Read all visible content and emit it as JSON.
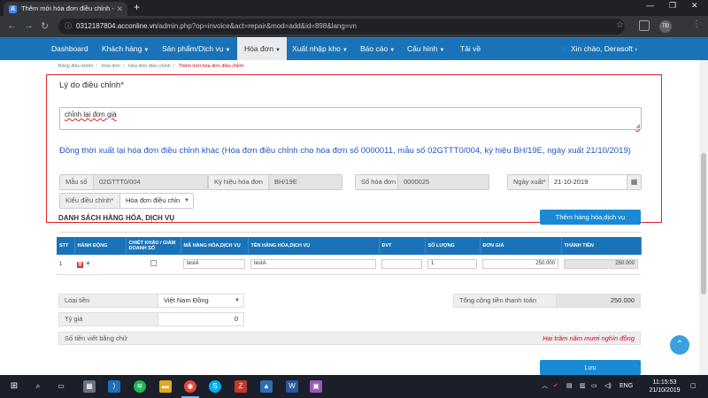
{
  "browser": {
    "tab_title": "Thêm mới hóa đơn điều chỉnh - ",
    "tab_favicon_letter": "A",
    "new_tab": "+",
    "url_host": "0312187804.acconline.vn",
    "url_path": "/admin.php?op=invoice&act=repair&mod=add&id=898&lang=vn",
    "profile_initials": "TĐ"
  },
  "nav": {
    "items": [
      {
        "label": "Dashboard",
        "caret": false
      },
      {
        "label": "Khách hàng",
        "caret": true
      },
      {
        "label": "Sản phẩm/Dịch vụ",
        "caret": true
      },
      {
        "label": "Hóa đơn",
        "caret": true,
        "active": true
      },
      {
        "label": "Xuất nhập kho",
        "caret": true
      },
      {
        "label": "Báo cáo",
        "caret": true
      },
      {
        "label": "Cấu hình",
        "caret": true
      },
      {
        "label": "Tải về",
        "caret": false
      }
    ],
    "user_greeting": "Xin chào, Derasoft"
  },
  "breadcrumb": [
    "Bảng điều khiển",
    "Hóa đơn",
    "Hóa đơn điều chỉnh",
    "Thêm mới hóa đơn điều chỉnh"
  ],
  "form": {
    "reason_label": "Lý do điều chỉnh*",
    "reason_value": "chỉnh lại đơn giá",
    "notice": "Đồng thời xuất lại hóa đơn điều chỉnh khác (Hóa đơn điều chỉnh cho hóa đơn số 0000011, mẫu số 02GTTT0/004, ký hiệu BH/19E, ngày xuất 21/10/2019)",
    "mau_so_label": "Mẫu số",
    "mau_so_value": "02GTTT0/004",
    "ky_hieu_label": "Ký hiệu hóa đơn",
    "ky_hieu_value": "BH/19E",
    "so_hd_label": "Số hóa đơn",
    "so_hd_value": "0000025",
    "ngay_xuat_label": "Ngày xuất*",
    "ngay_xuat_value": "21-10-2019",
    "kieu_label": "Kiểu điều chỉnh*",
    "kieu_value": "Hóa đơn điều chỉn"
  },
  "items_section": {
    "title": "DANH SÁCH HÀNG HÓA, DỊCH VỤ",
    "add_button": "Thêm hàng hóa,dịch vụ",
    "columns": [
      "STT",
      "HÀNH ĐỘNG",
      "CHIẾT KHẤU / GIẢM DOANH SỐ",
      "MÃ HÀNG HÓA,DỊCH VỤ",
      "TÊN HÀNG HÓA,DỊCH VỤ",
      "ĐVT",
      "SỐ LƯỢNG",
      "ĐƠN GIÁ",
      "THÀNH TIỀN"
    ],
    "rows": [
      {
        "stt": "1",
        "ma": "testA",
        "ten": "testA",
        "dvt": "",
        "so_luong": "1",
        "don_gia": "250.000",
        "thanh_tien": "250.000"
      }
    ]
  },
  "summary": {
    "loai_tien_label": "Loại tiền",
    "loai_tien_value": "Việt Nam Đồng",
    "ty_gia_label": "Tỷ giá",
    "ty_gia_value": "0",
    "tong_label": "Tổng cộng tiền thanh toán",
    "tong_value": "250.000",
    "words_label": "Số tiền viết bằng chữ",
    "words_value": "Hai trăm năm mươi nghìn đồng",
    "save_button": "Lưu"
  },
  "taskbar": {
    "lang": "ENG",
    "time": "11:15:53",
    "date": "21/10/2019"
  },
  "colors": {
    "navbar": "#1a73b8",
    "highlight_border": "#e0232e",
    "notice_text": "#1f56c6",
    "primary_button": "#1a8ad4"
  }
}
